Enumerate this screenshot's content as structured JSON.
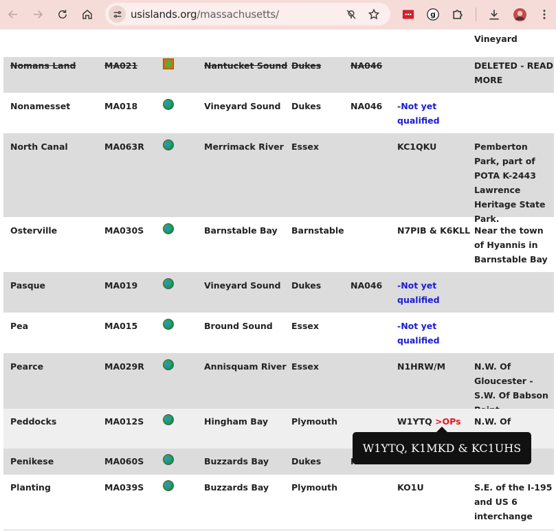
{
  "browser": {
    "url_host": "usislands.org",
    "url_path": "/massachusetts/"
  },
  "rows": [
    {
      "name": "",
      "id": "",
      "water": "",
      "county": "",
      "iota": "",
      "activated": "",
      "notes": "Vineyard",
      "flag": "none",
      "style": "white"
    },
    {
      "name": "Nomans Land",
      "id": "MA021",
      "water": "Nantucket Sound",
      "county": "Dukes",
      "iota": "NA046",
      "activated": "",
      "notes": "DELETED - READ MORE",
      "flag": "deleted",
      "style": "gray"
    },
    {
      "name": "Nonamesset",
      "id": "MA018",
      "water": "Vineyard Sound",
      "county": "Dukes",
      "iota": "NA046",
      "activated": "-Not yet qualified",
      "notes": "",
      "flag": "globe",
      "style": "white"
    },
    {
      "name": "North Canal",
      "id": "MA063R",
      "water": "Merrimack River",
      "county": "Essex",
      "iota": "",
      "activated": "KC1QKU",
      "notes": "Pemberton Park, part of POTA K-2443 Lawrence Heritage State Park.",
      "flag": "globe",
      "style": "gray"
    },
    {
      "name": "Osterville",
      "id": "MA030S",
      "water": "Barnstable Bay",
      "county": "Barnstable",
      "iota": "",
      "activated": "N7PIB & K6KLL",
      "notes": "Near the town of Hyannis in Barnstable Bay",
      "flag": "globe",
      "style": "white"
    },
    {
      "name": "Pasque",
      "id": "MA019",
      "water": "Vineyard Sound",
      "county": "Dukes",
      "iota": "NA046",
      "activated": "-Not yet qualified",
      "notes": "",
      "flag": "globe",
      "style": "gray"
    },
    {
      "name": "Pea",
      "id": "MA015",
      "water": "Bround Sound",
      "county": "Essex",
      "iota": "",
      "activated": "-Not yet qualified",
      "notes": "",
      "flag": "globe",
      "style": "white"
    },
    {
      "name": "Pearce",
      "id": "MA029R",
      "water": "Annisquam River",
      "county": "Essex",
      "iota": "",
      "activated": "N1HRW/M",
      "notes": "N.W. Of Gloucester - S.W. Of Babson Point",
      "flag": "globe",
      "style": "gray"
    },
    {
      "name": "Peddocks",
      "id": "MA012S",
      "water": "Hingham Bay",
      "county": "Plymouth",
      "iota": "",
      "activated": "W1YTQ",
      "activated_link": ">OPs",
      "notes": "N.W. Of Hingham",
      "flag": "globe",
      "style": "hover"
    },
    {
      "name": "Penikese",
      "id": "MA060S",
      "water": "Buzzards Bay",
      "county": "Dukes",
      "iota": "NA046",
      "activated": "",
      "notes": "",
      "flag": "globe",
      "style": "gray"
    },
    {
      "name": "Planting",
      "id": "MA039S",
      "water": "Buzzards Bay",
      "county": "Plymouth",
      "iota": "",
      "activated": "KO1U",
      "notes": "S.E. of the I-195 and US 6 interchange",
      "flag": "globe",
      "style": "white"
    }
  ],
  "tooltip": "W1YTQ, K1MKD & KC1UHS"
}
